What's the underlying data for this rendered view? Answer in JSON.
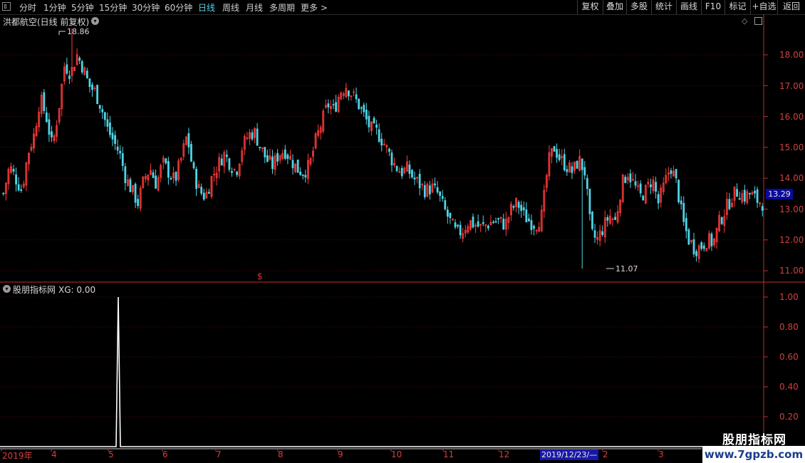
{
  "toolbar": {
    "periods": [
      "分时",
      "1分钟",
      "5分钟",
      "15分钟",
      "30分钟",
      "60分钟",
      "日线",
      "周线",
      "月线",
      "多周期",
      "更多 >"
    ],
    "active_period": "日线",
    "right_buttons": [
      "复权",
      "叠加",
      "多股",
      "统计",
      "画线",
      "F10",
      "标记",
      "+自选",
      "返回"
    ]
  },
  "main_pane": {
    "title": "洪都航空(日线 前复权)",
    "current_price": "13.29",
    "high_label": "18.86",
    "low_label": "11.07",
    "signal_mark": "$"
  },
  "indicator_pane": {
    "title": "股朋指标网",
    "value_text": "XG: 0.00"
  },
  "price_axis": [
    "18.00",
    "17.00",
    "16.00",
    "15.00",
    "14.00",
    "13.00",
    "12.00",
    "11.00"
  ],
  "indicator_axis": [
    "1.00",
    "0.80",
    "0.60",
    "0.40",
    "0.20"
  ],
  "date_axis": [
    "2019年",
    "4",
    "5",
    "6",
    "7",
    "8",
    "9",
    "10",
    "11",
    "12",
    "2",
    "3"
  ],
  "cursor_date": "2019/12/23/—",
  "watermark": {
    "name": "股朋指标网",
    "url": "www.7gpzb.com"
  },
  "colors": {
    "up": "#ff3b3b",
    "down": "#4fd5e6",
    "axis": "#c03030",
    "grid": "#5a1010"
  },
  "chart_data": {
    "type": "candlestick",
    "price_ylim": [
      10.9,
      19.0
    ],
    "indicator_ylim": [
      0,
      1.0
    ],
    "indicator_series": {
      "name": "XG",
      "spike_value": 1.0,
      "spike_date": "2019/5"
    },
    "close_path": [
      13.5,
      14.4,
      14.0,
      13.6,
      14.8,
      15.4,
      16.6,
      16.0,
      15.0,
      16.2,
      17.7,
      17.4,
      18.0,
      17.6,
      17.0,
      16.8,
      16.3,
      15.6,
      15.2,
      14.8,
      14.0,
      13.6,
      13.2,
      14.0,
      14.3,
      13.8,
      14.5,
      14.2,
      13.9,
      14.6,
      15.4,
      14.2,
      13.6,
      13.4,
      14.0,
      14.4,
      14.8,
      14.5,
      14.2,
      15.0,
      15.4,
      15.5,
      15.0,
      14.6,
      14.4,
      14.8,
      14.9,
      14.6,
      14.3,
      14.2,
      14.4,
      15.2,
      15.8,
      16.4,
      16.2,
      16.8,
      17.0,
      16.7,
      16.4,
      16.0,
      15.6,
      15.5,
      15.2,
      14.8,
      14.4,
      14.2,
      14.3,
      14.0,
      13.8,
      13.6,
      13.7,
      13.5,
      13.0,
      12.6,
      12.2,
      12.3,
      12.6,
      12.5,
      12.4,
      12.5,
      12.6,
      12.6,
      12.5,
      13.0,
      13.2,
      12.8,
      12.6,
      12.5,
      12.8,
      14.5,
      15.0,
      14.6,
      14.4,
      14.2,
      14.6,
      14.2,
      12.2,
      12.0,
      12.4,
      12.8,
      12.6,
      13.8,
      14.2,
      13.8,
      13.4,
      13.6,
      14.0,
      13.2,
      13.8,
      14.4,
      13.8,
      12.6,
      12.0,
      11.7,
      11.8,
      12.0,
      11.9,
      12.6,
      13.0,
      13.4,
      13.6,
      13.4,
      13.5,
      13.3,
      13.2
    ]
  }
}
